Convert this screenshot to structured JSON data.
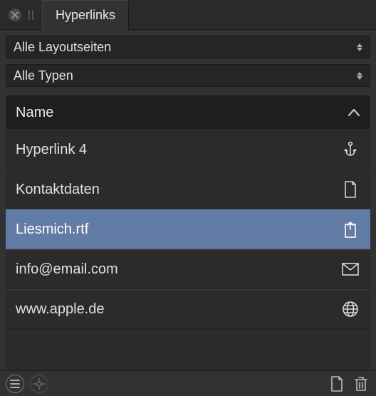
{
  "tab": {
    "title": "Hyperlinks"
  },
  "dropdowns": {
    "layout": "Alle Layoutseiten",
    "types": "Alle Typen"
  },
  "list": {
    "header": "Name",
    "rows": [
      {
        "label": "Hyperlink 4",
        "icon": "anchor",
        "selected": false
      },
      {
        "label": "Kontaktdaten",
        "icon": "page",
        "selected": false
      },
      {
        "label": "Liesmich.rtf",
        "icon": "external",
        "selected": true
      },
      {
        "label": "info@email.com",
        "icon": "mail",
        "selected": false
      },
      {
        "label": "www.apple.de",
        "icon": "globe",
        "selected": false
      }
    ]
  }
}
